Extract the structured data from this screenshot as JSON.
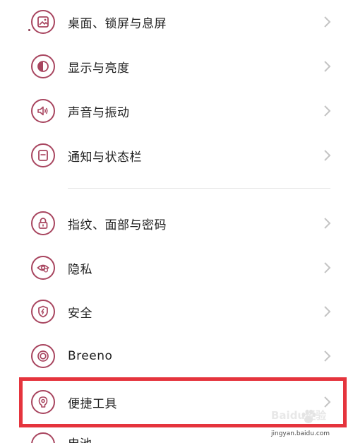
{
  "settings": {
    "items": [
      {
        "label": "桌面、锁屏与息屏",
        "icon": "wallpaper-icon"
      },
      {
        "label": "显示与亮度",
        "icon": "brightness-icon"
      },
      {
        "label": "声音与振动",
        "icon": "speaker-icon"
      },
      {
        "label": "通知与状态栏",
        "icon": "notification-icon"
      },
      {
        "label": "指纹、面部与密码",
        "icon": "lock-icon"
      },
      {
        "label": "隐私",
        "icon": "privacy-eye-icon"
      },
      {
        "label": "安全",
        "icon": "shield-icon"
      },
      {
        "label": "Breeno",
        "icon": "breeno-icon"
      },
      {
        "label": "便捷工具",
        "icon": "convenience-tools-icon"
      },
      {
        "label": "电池",
        "icon": "battery-icon"
      }
    ]
  },
  "watermark": {
    "top_text": "Baidu经验",
    "bottom_text": "jingyan.baidu.com"
  },
  "colors": {
    "icon_accent": "#a8455f",
    "highlight_border": "#e5343d",
    "chevron": "#c4c4c4",
    "divider": "#e6e6e6"
  }
}
